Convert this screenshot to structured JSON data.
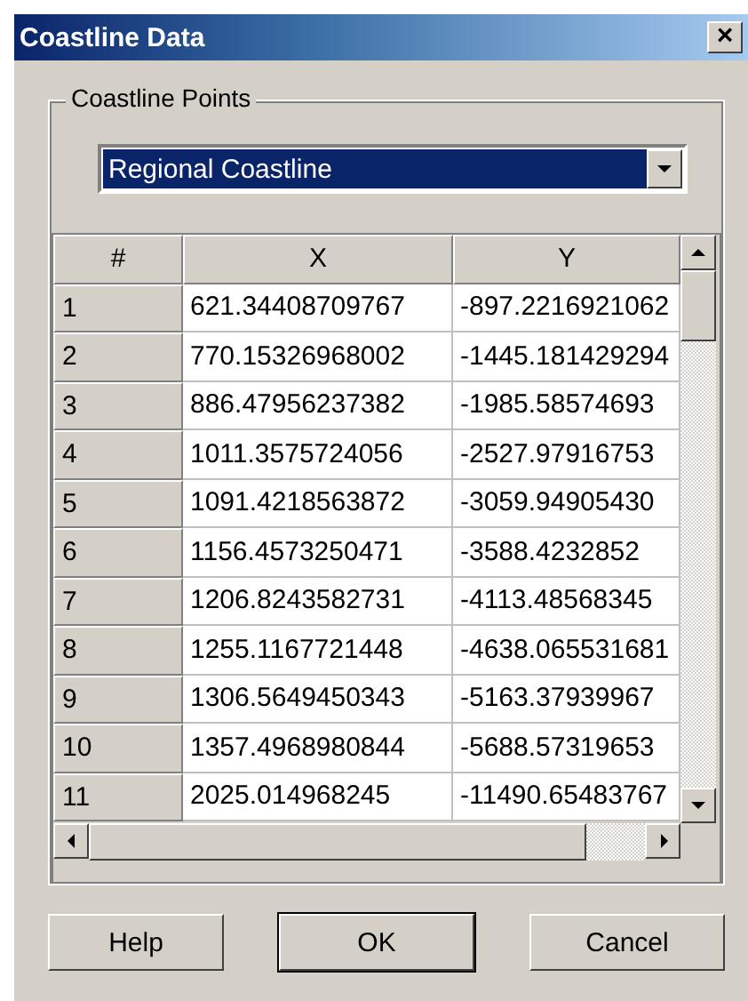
{
  "window": {
    "title": "Coastline Data",
    "close": "×"
  },
  "group": {
    "label": "Coastline Points"
  },
  "dropdown": {
    "value": "Regional Coastline",
    "focused": true
  },
  "table": {
    "columns": [
      "#",
      "X",
      "Y"
    ],
    "rows": [
      [
        "1",
        "621.34408709767",
        "-897.2216921062"
      ],
      [
        "2",
        "770.15326968002",
        "-1445.181429294"
      ],
      [
        "3",
        "886.47956237382",
        "-1985.58574693"
      ],
      [
        "4",
        "1011.3575724056",
        "-2527.97916753"
      ],
      [
        "5",
        "1091.4218563872",
        "-3059.94905430"
      ],
      [
        "6",
        "1156.4573250471",
        "-3588.4232852"
      ],
      [
        "7",
        "1206.8243582731",
        "-4113.48568345"
      ],
      [
        "8",
        "1255.1167721448",
        "-4638.065531681"
      ],
      [
        "9",
        "1306.5649450343",
        "-5163.37939967"
      ],
      [
        "10",
        "1357.4968980844",
        "-5688.57319653"
      ],
      [
        "11",
        "2025.014968245",
        "-11490.65483767"
      ]
    ]
  },
  "buttons": [
    {
      "label": "Help",
      "default": false
    },
    {
      "label": "OK",
      "default": true
    },
    {
      "label": "Cancel",
      "default": false
    }
  ]
}
